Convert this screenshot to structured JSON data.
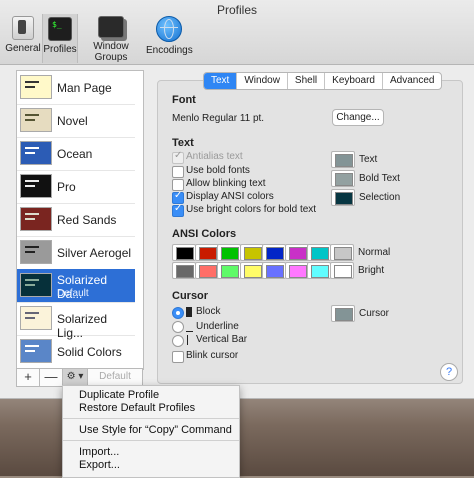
{
  "window": {
    "title": "Profiles"
  },
  "toolbar": [
    {
      "label": "General",
      "icon": "general-icon"
    },
    {
      "label": "Profiles",
      "icon": "profiles-icon"
    },
    {
      "label": "Window Groups",
      "icon": "window-groups-icon"
    },
    {
      "label": "Encodings",
      "icon": "encodings-icon"
    }
  ],
  "profiles": [
    {
      "name": "Man Page"
    },
    {
      "name": "Novel"
    },
    {
      "name": "Ocean"
    },
    {
      "name": "Pro"
    },
    {
      "name": "Red Sands"
    },
    {
      "name": "Silver Aerogel"
    },
    {
      "name": "Solarized Da...",
      "sub": "Default"
    },
    {
      "name": "Solarized Lig..."
    },
    {
      "name": "Solid Colors"
    }
  ],
  "sidebar_buttons": {
    "add": "+",
    "remove": "—",
    "gear": "⚙ ▾",
    "default": "Default"
  },
  "tabs": [
    "Text",
    "Window",
    "Shell",
    "Keyboard",
    "Advanced"
  ],
  "font": {
    "heading": "Font",
    "value": "Menlo Regular 11 pt.",
    "change": "Change..."
  },
  "text": {
    "heading": "Text",
    "options": [
      "Antialias text",
      "Use bold fonts",
      "Allow blinking text",
      "Display ANSI colors",
      "Use bright colors for bold text"
    ],
    "colors": [
      "Text",
      "Bold Text",
      "Selection"
    ]
  },
  "ansi": {
    "heading": "ANSI Colors",
    "normal_label": "Normal",
    "bright_label": "Bright",
    "normal": [
      "#000000",
      "#c91b00",
      "#00c200",
      "#c7c400",
      "#0225c7",
      "#c930c7",
      "#00c5c7",
      "#c7c7c7"
    ],
    "bright": [
      "#686868",
      "#ff6e67",
      "#5ffa68",
      "#fffc67",
      "#6871ff",
      "#ff77ff",
      "#60fdff",
      "#ffffff"
    ]
  },
  "cursor": {
    "heading": "Cursor",
    "options": [
      "Block",
      "Underline",
      "Vertical Bar"
    ],
    "blink": "Blink cursor",
    "color_label": "Cursor"
  },
  "help": "?",
  "menu": {
    "items": [
      "Duplicate Profile",
      "Restore Default Profiles",
      "Use Style for “Copy” Command",
      "Import...",
      "Export..."
    ]
  }
}
